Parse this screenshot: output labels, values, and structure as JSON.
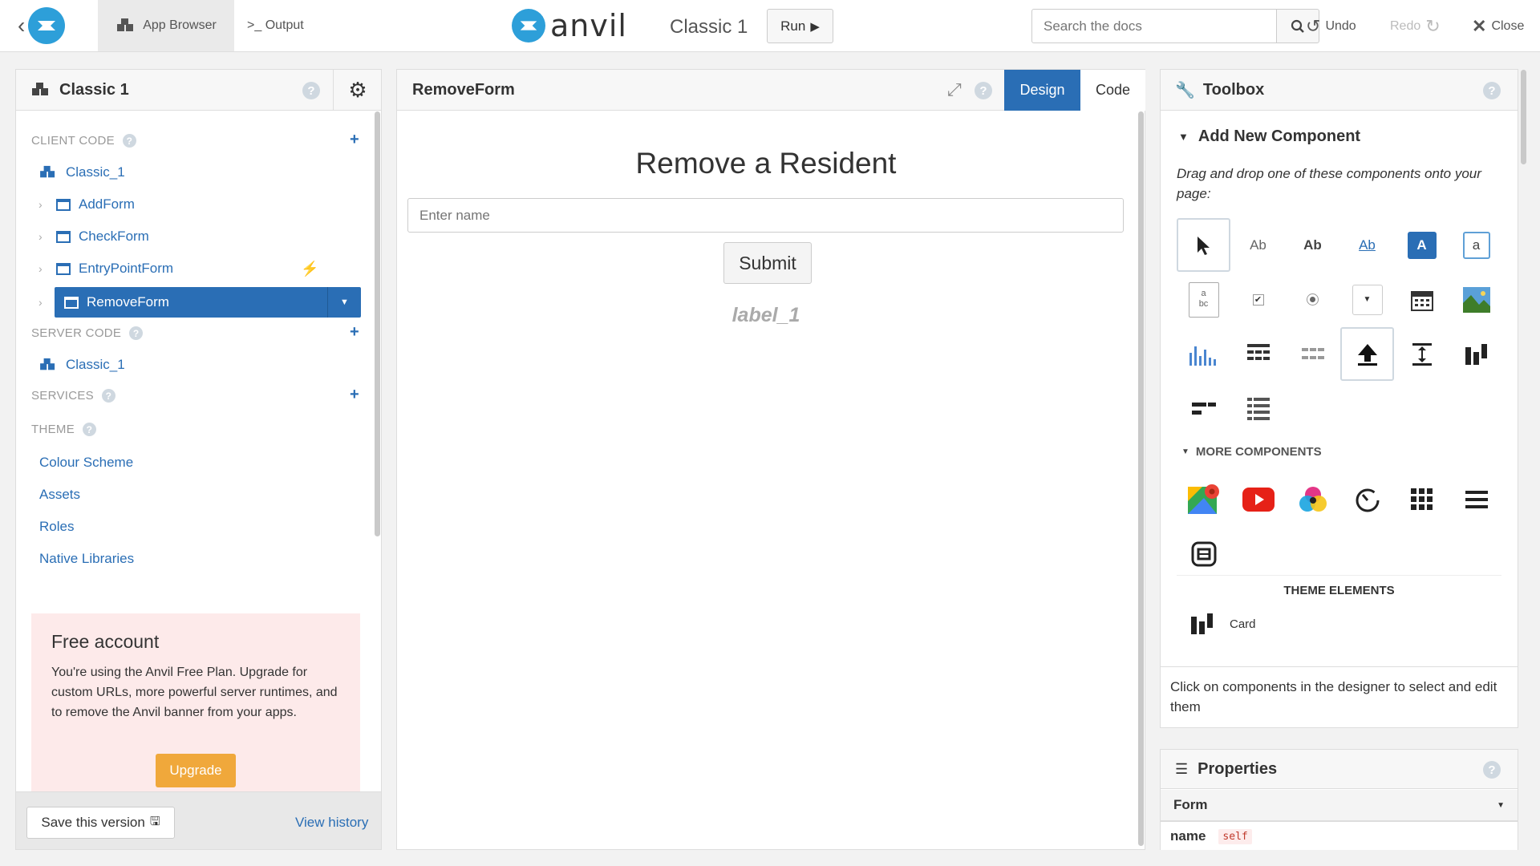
{
  "topbar": {
    "app_browser": "App Browser",
    "output": ">_ Output",
    "brand": "anvil",
    "app_title": "Classic 1",
    "run": "Run",
    "search_placeholder": "Search the docs",
    "undo": "Undo",
    "redo": "Redo",
    "close": "Close"
  },
  "sidebar": {
    "title": "Classic 1",
    "client_code": "CLIENT CODE",
    "client_root": "Classic_1",
    "forms": [
      "AddForm",
      "CheckForm",
      "EntryPointForm",
      "RemoveForm"
    ],
    "server_code": "SERVER CODE",
    "server_root": "Classic_1",
    "services": "SERVICES",
    "theme": "THEME",
    "theme_items": [
      "Colour Scheme",
      "Assets",
      "Roles",
      "Native Libraries"
    ],
    "free_title": "Free account",
    "free_text": "You're using the Anvil Free Plan. Upgrade for custom URLs, more powerful server runtimes, and to remove the Anvil banner from your apps.",
    "upgrade": "Upgrade",
    "save_version": "Save this version",
    "view_history": "View history"
  },
  "editor": {
    "form_name": "RemoveForm",
    "tab_design": "Design",
    "tab_code": "Code",
    "heading": "Remove a Resident",
    "input_placeholder": "Enter name",
    "submit": "Submit",
    "label": "label_1"
  },
  "toolbox": {
    "title": "Toolbox",
    "add_new": "Add New Component",
    "instructions": "Drag and drop one of these components onto your page:",
    "text_label": "Ab",
    "text_bold": "Ab",
    "text_link": "Ab",
    "text_button": "A",
    "text_input": "a",
    "textarea_a": "a",
    "textarea_bc": "bc",
    "more_components": "MORE COMPONENTS",
    "theme_elements": "THEME ELEMENTS",
    "card": "Card",
    "footer_hint": "Click on components in the designer to select and edit them"
  },
  "properties": {
    "title": "Properties",
    "selected": "Form",
    "name_key": "name",
    "name_value": "self"
  },
  "colors": {
    "accent": "#2a6eb5",
    "logo_blue": "#2d9fd9",
    "upgrade": "#f0a83b",
    "free_bg": "#fdeaea"
  }
}
